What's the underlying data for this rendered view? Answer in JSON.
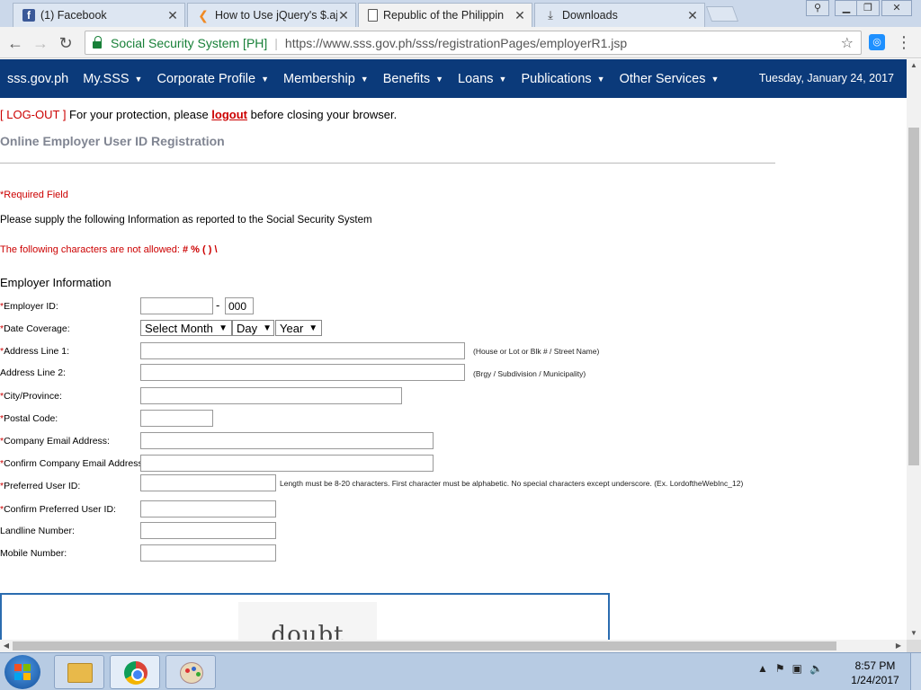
{
  "browser": {
    "tabs": [
      {
        "title": "(1) Facebook",
        "icon": "facebook-icon"
      },
      {
        "title": "How to Use jQuery's $.aja",
        "icon": "jquery-icon"
      },
      {
        "title": "Republic of the Philippin",
        "icon": "document-icon"
      },
      {
        "title": "Downloads",
        "icon": "download-icon"
      }
    ],
    "address_bar": {
      "secure_label": "Social Security System [PH]",
      "url": "https://www.sss.gov.ph/sss/registrationPages/employerR1.jsp"
    }
  },
  "site_nav": {
    "items": [
      {
        "label": "sss.gov.ph",
        "dropdown": false
      },
      {
        "label": "My.SSS",
        "dropdown": true
      },
      {
        "label": "Corporate Profile",
        "dropdown": true
      },
      {
        "label": "Membership",
        "dropdown": true
      },
      {
        "label": "Benefits",
        "dropdown": true
      },
      {
        "label": "Loans",
        "dropdown": true
      },
      {
        "label": "Publications",
        "dropdown": true
      },
      {
        "label": "Other Services",
        "dropdown": true
      }
    ],
    "date": "Tuesday, January 24, 2017"
  },
  "logout": {
    "bracket": "[ LOG-OUT ]",
    "pre": " For your protection, please ",
    "link": "logout",
    "post": " before closing your browser."
  },
  "page_title": "Online Employer User ID Registration",
  "notes": {
    "required": "*Required Field",
    "supply": "Please supply the following Information as reported to the Social Security System",
    "not_allowed_prefix": "The following characters are not allowed: ",
    "not_allowed_chars": "# % ( ) \\"
  },
  "section_title": "Employer Information",
  "form": {
    "employer_id": {
      "label": "Employer ID:",
      "required": true,
      "value": "",
      "suffix_value": "000"
    },
    "date_coverage": {
      "label": "Date Coverage:",
      "required": true,
      "month": "Select Month",
      "day": "Day",
      "year": "Year"
    },
    "address1": {
      "label": "Address Line 1:",
      "required": true,
      "hint": "(House or Lot or Blk # / Street Name)"
    },
    "address2": {
      "label": "Address Line 2:",
      "required": false,
      "hint": "(Brgy / Subdivision / Municipality)"
    },
    "city": {
      "label": "City/Province:",
      "required": true
    },
    "postal": {
      "label": "Postal Code:",
      "required": true
    },
    "email": {
      "label": "Company Email Address:",
      "required": true
    },
    "confirm_email": {
      "label": "Confirm Company Email Address:",
      "required": true
    },
    "user_id": {
      "label": "Preferred User ID:",
      "required": true,
      "hint": "Length must be 8-20 characters. First character must be alphabetic. No special characters except underscore. (Ex. LordoftheWebInc_12)"
    },
    "confirm_user_id": {
      "label": "Confirm Preferred User ID:",
      "required": true
    },
    "landline": {
      "label": "Landline Number:",
      "required": false
    },
    "mobile": {
      "label": "Mobile Number:",
      "required": false
    }
  },
  "captcha": {
    "text": "doubt"
  },
  "taskbar": {
    "time": "8:57 PM",
    "date": "1/24/2017"
  },
  "colors": {
    "nav_bg": "#0b3a7a",
    "required_red": "#cc0000",
    "heading_gray": "#808592",
    "secure_green": "#188038"
  }
}
